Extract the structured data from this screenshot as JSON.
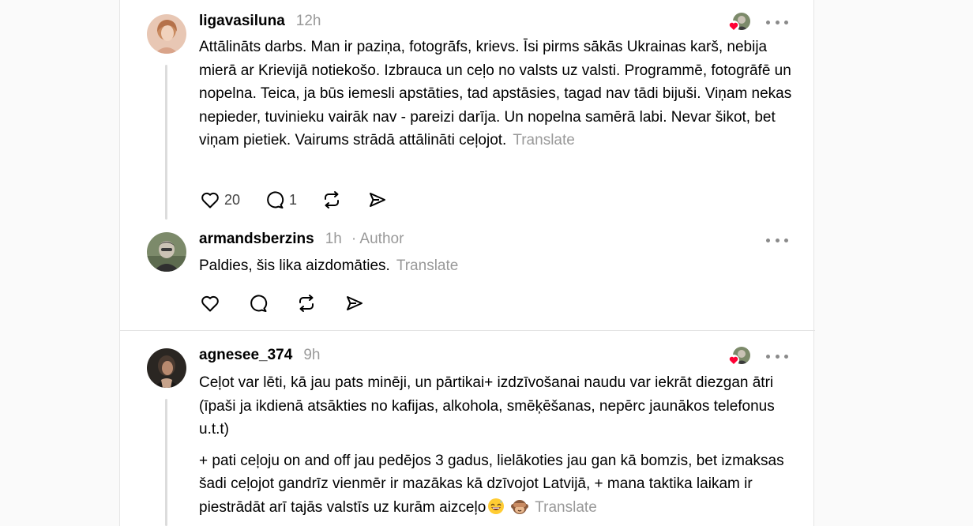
{
  "comments": [
    {
      "username": "ligavasiluna",
      "time": "12h",
      "text": "Attālināts darbs. Man ir paziņa, fotogrāfs, krievs. Īsi pirms sākās Ukrainas karš, nebija mierā ar Krievijā notiekošo. Izbrauca un ceļo no valsts uz valsti. Programmē, fotogrāfē un nopelna. Teica, ja būs iemesli apstāties, tad apstāsies, tagad nav tādi bijuši. Viņam nekas nepieder, tuvinieku vairāk nav - pareizi darīja. Un nopelna samērā labi. Nevar šikot, bet viņam pietiek. Vairums strādā attālināti ceļojot.",
      "translate": "Translate",
      "likes": "20",
      "replies": "1"
    },
    {
      "username": "armandsberzins",
      "time": "1h",
      "author_tag": "· Author",
      "text": "Paldies, šis lika aizdomāties.",
      "translate": "Translate"
    },
    {
      "username": "agnesee_374",
      "time": "9h",
      "text_p1": "Ceļot var lēti, kā jau pats minēji, un pārtikai+ izdzīvošanai naudu var iekrāt diezgan ātri (īpaši ja ikdienā atsākties no kafijas, alkohola, smēķēšanas, nepērc jaunākos telefonus u.t.t)",
      "text_p2": "+ pati ceļoju on and off jau pedējos 3 gadus, lielākoties jau gan kā bomzis, bet izmaksas šadi ceļojot gandrīz vienmēr ir mazākas kā dzīvojot Latvijā, + mana taktika laikam ir piestrādāt arī tajās valstīs uz kurām aizceļo",
      "emojis": [
        "grinning-sweat-emoji",
        "see-no-evil-monkey-emoji"
      ],
      "translate": "Translate"
    }
  ],
  "colors": {
    "text": "#000000",
    "muted": "#999999",
    "heart": "#ff0034",
    "icon": "#000000",
    "divider": "#e3e3e3",
    "thread_line": "#dcdcdc"
  },
  "icons": {
    "like": "heart-outline-icon",
    "reply": "speech-bubble-icon",
    "repost": "repost-arrows-icon",
    "share": "paper-plane-icon",
    "more": "more-dots-icon"
  }
}
